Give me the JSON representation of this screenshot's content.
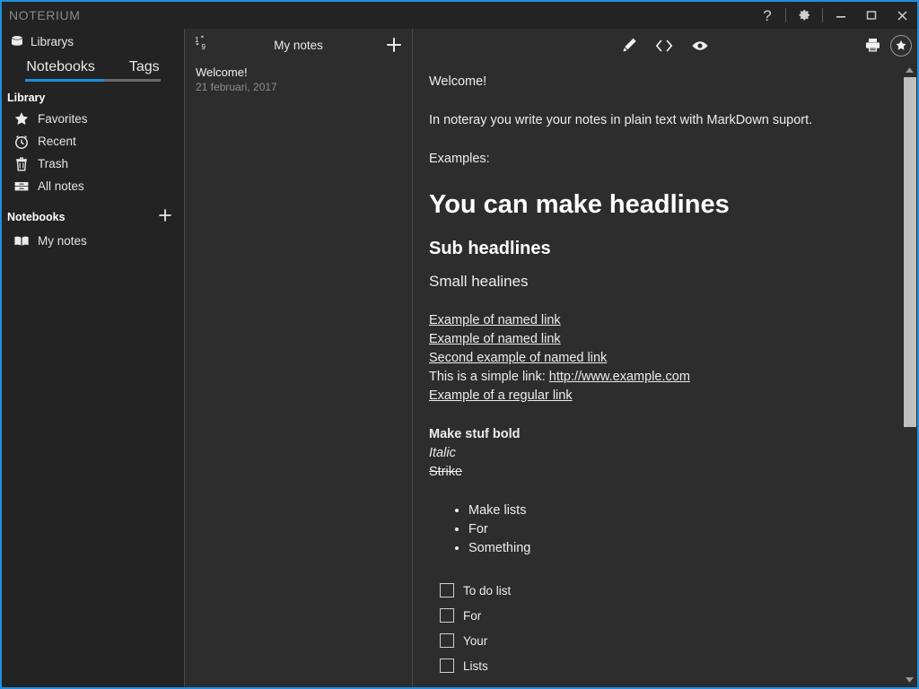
{
  "app": {
    "title": "NOTERIUM",
    "accent_color": "#1e8fe0",
    "sidebar_bg": "#232323",
    "panel_bg": "#2d2d2d"
  },
  "titlebar": {
    "help_label": "?",
    "settings_label": "settings",
    "minimize_label": "minimize",
    "maximize_label": "maximize",
    "close_label": "close"
  },
  "sidebar": {
    "libraries_label": "Librarys",
    "tabs": [
      {
        "label": "Notebooks",
        "active": true
      },
      {
        "label": "Tags",
        "active": false
      }
    ],
    "library_section": {
      "heading": "Library",
      "items": [
        {
          "label": "Favorites",
          "icon": "star-icon"
        },
        {
          "label": "Recent",
          "icon": "clock-icon"
        },
        {
          "label": "Trash",
          "icon": "trash-icon"
        },
        {
          "label": "All notes",
          "icon": "drawer-icon"
        }
      ]
    },
    "notebooks_section": {
      "heading": "Notebooks",
      "add_label": "+",
      "items": [
        {
          "label": "My notes",
          "icon": "book-icon"
        }
      ]
    }
  },
  "notelist": {
    "sort_icon": "sort-numeric-icon",
    "title": "My notes",
    "add_label": "+",
    "notes": [
      {
        "title": "Welcome!",
        "date": "21 februari, 2017"
      }
    ]
  },
  "editor": {
    "toolbar": {
      "edit_icon": "pencil-icon",
      "source_icon": "code-icon",
      "preview_icon": "eye-icon",
      "print_icon": "printer-icon",
      "favorite_icon": "star-circle-icon"
    },
    "note": {
      "title": "Welcome!",
      "intro": "In noteray you write your notes in plain text with MarkDown suport.",
      "examples_label": "Examples:",
      "h1": "You can make headlines",
      "h2": "Sub headlines",
      "h3": "Small healines",
      "links": [
        {
          "text": "Example of named link",
          "prefix": ""
        },
        {
          "text": "Example of named link",
          "prefix": ""
        },
        {
          "text": "Second example of named link",
          "prefix": ""
        },
        {
          "text": "http://www.example.com",
          "prefix": "This is a simple link: "
        },
        {
          "text": "Example of a regular link",
          "prefix": ""
        }
      ],
      "formats": {
        "bold": "Make stuf bold",
        "italic": "Italic",
        "strike": "Strike"
      },
      "bullets": [
        "Make lists",
        "For",
        "Something"
      ],
      "todos": [
        {
          "label": "To do list",
          "checked": false
        },
        {
          "label": "For",
          "checked": false
        },
        {
          "label": "Your",
          "checked": false
        },
        {
          "label": "Lists",
          "checked": false
        }
      ]
    }
  }
}
